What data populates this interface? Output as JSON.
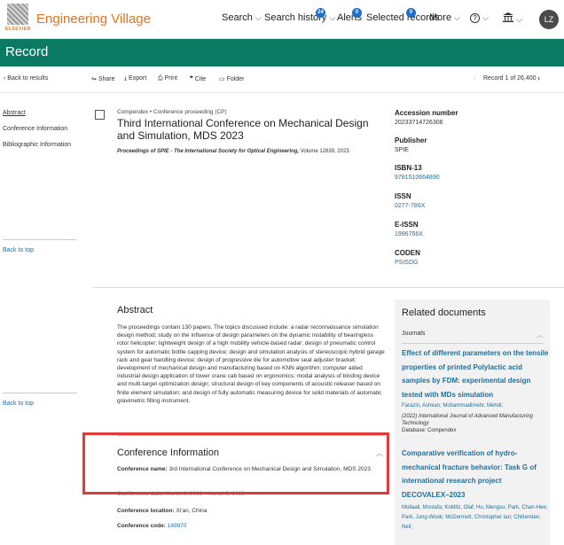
{
  "header": {
    "brand": "Engineering Village",
    "logo_text": "ELSEVIER",
    "nav": {
      "search": "Search",
      "search_history": "Search history",
      "search_history_count": "24",
      "alerts": "Alerts",
      "alerts_count": "0",
      "selected_records": "Selected records",
      "selected_count": "0",
      "more": "More",
      "help": "?",
      "avatar": "LZ"
    }
  },
  "page": {
    "title": "Record"
  },
  "toolbar": {
    "back": "Back to results",
    "share": "Share",
    "export": "Export",
    "print": "Print",
    "cite": "Cite",
    "folder": "Folder",
    "record_position": "Record 1 of 26,400"
  },
  "sidebar": {
    "abstract": "Abstract",
    "conference_information": "Conference Information",
    "bibliographic_information": "Bibliographic Information",
    "back_to_top_1": "Back to top",
    "back_to_top_2": "Back to top"
  },
  "record": {
    "meta": "Compendex  •  Conference proceeding (CP)",
    "title": "Third International Conference on Mechanical Design and Simulation, MDS 2023",
    "source_journal": "Proceedings of SPIE - The International Society for Optical Engineering,",
    "source_volume": " Volume 12639, 2023"
  },
  "details": {
    "accession_label": "Accession number",
    "accession_value": "20233714726306",
    "publisher_label": "Publisher",
    "publisher_value": "SPIE",
    "isbn_label": "ISBN-13",
    "isbn_value": "9781510664890",
    "issn_label": "ISSN",
    "issn_value": "0277-786X",
    "eissn_label": "E-ISSN",
    "eissn_value": "1996756X",
    "coden_label": "CODEN",
    "coden_value": "PSISDG"
  },
  "abstract": {
    "heading": "Abstract",
    "text": "The proceedings contain 130 papers. The topics discussed include: a radar reconnaissance simulation design method; study on the influence of design parameters on the dynamic instability of bearingless rotor helicopter; lightweight design of a high mobility vehicle-based radar; design of pneumatic control system for automatic bottle capping device; design and simulation analysis of stereoscopic hybrid garage rack and gear handling device; design of progressive die for automotive seat adjuster bracket; development of mechanical design and manufacturing based on KNN algorithm; computer aided industrial design application of tower crane cab based on ergonomics; modal analysis of binding device and multi-target optimization design; structural design of key components of acoustic releaser based on finite element simulation; and design of fully automatic measuring device for solid materials of automatic gravimetric filling instrument."
  },
  "conference": {
    "heading": "Conference Information",
    "name_label": "Conference name:",
    "name_value": "3rd International Conference on Mechanical Design and Simulation, MDS 2023",
    "date_label": "Conference date:",
    "date_value": "March 3, 2023 - March 5, 2023",
    "location_label": "Conference location:",
    "location_value": "Xi'an, China",
    "code_label": "Conference code:",
    "code_value": "189970"
  },
  "related": {
    "heading": "Related documents",
    "section": "Journals",
    "doc1_title": "Effect of different parameters on the tensile properties of printed Polylactic acid samples by FDM: experimental design tested with MDs simulation",
    "doc1_authors": "Farazin, Ashkan; Mohammadimehr, Mehdi;",
    "doc1_source": "(2022) International Journal of Advanced Manufacturing Technology",
    "doc1_db": "Database: Compendex",
    "doc2_title": "Comparative verification of hydro-mechanical fracture behavior: Task G of international research project DECOVALEX–2023",
    "doc2_authors": "Mollaali, Mostafa; Kolditz, Olaf; Hu, Mengsu; Park, Chan-Hee; Park, Jung-Wook; McDermott, Christopher Ian; Chittenden, Neil;"
  },
  "colors": {
    "brand": "#e9711c",
    "bar": "#0b7a63",
    "link": "#1a6fb0",
    "highlight": "#e53935"
  }
}
